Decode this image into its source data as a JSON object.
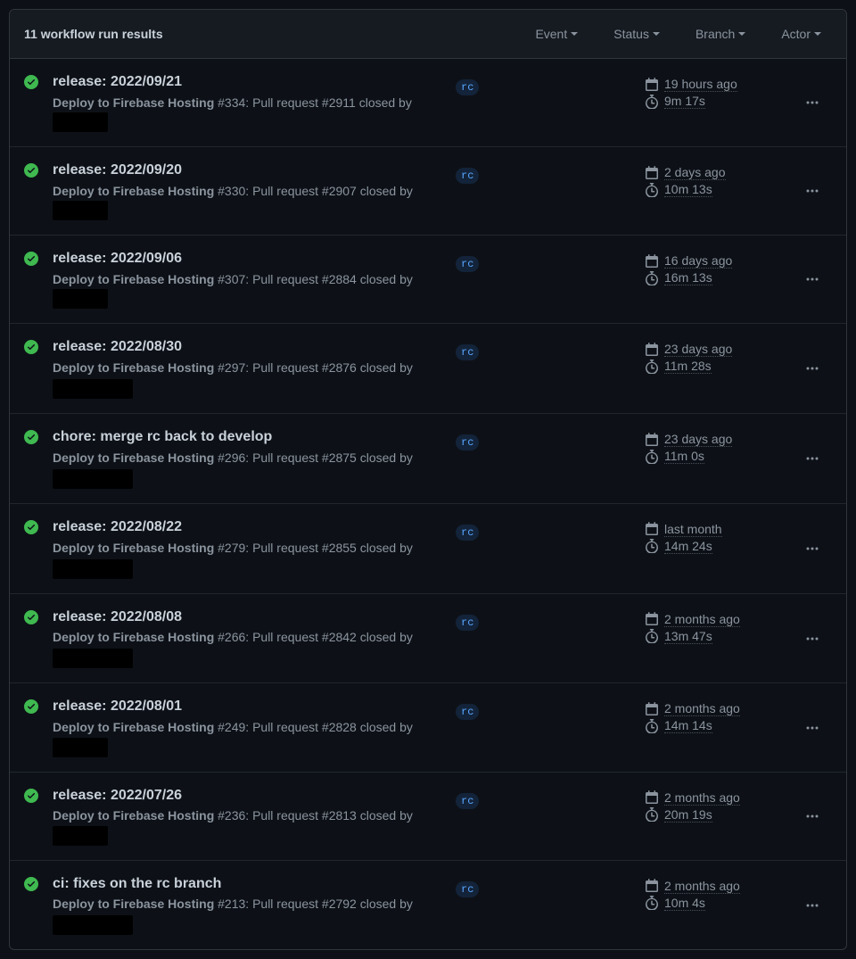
{
  "header": {
    "title": "11 workflow run results",
    "filters": {
      "event": "Event",
      "status": "Status",
      "branch": "Branch",
      "actor": "Actor"
    }
  },
  "workflow_name": "Deploy to Firebase Hosting",
  "runs": [
    {
      "title": "release: 2022/09/21",
      "run_number": "#334",
      "pr": "#2911",
      "branch": "rc",
      "age": "19 hours ago",
      "duration": "9m 17s",
      "redact_inline": true
    },
    {
      "title": "release: 2022/09/20",
      "run_number": "#330",
      "pr": "#2907",
      "branch": "rc",
      "age": "2 days ago",
      "duration": "10m 13s",
      "redact_inline": true
    },
    {
      "title": "release: 2022/09/06",
      "run_number": "#307",
      "pr": "#2884",
      "branch": "rc",
      "age": "16 days ago",
      "duration": "16m 13s",
      "redact_inline": true
    },
    {
      "title": "release: 2022/08/30",
      "run_number": "#297",
      "pr": "#2876",
      "branch": "rc",
      "age": "23 days ago",
      "duration": "11m 28s",
      "redact_inline": false
    },
    {
      "title": "chore: merge rc back to develop",
      "run_number": "#296",
      "pr": "#2875",
      "branch": "rc",
      "age": "23 days ago",
      "duration": "11m 0s",
      "redact_inline": false
    },
    {
      "title": "release: 2022/08/22",
      "run_number": "#279",
      "pr": "#2855",
      "branch": "rc",
      "age": "last month",
      "duration": "14m 24s",
      "redact_inline": false
    },
    {
      "title": "release: 2022/08/08",
      "run_number": "#266",
      "pr": "#2842",
      "branch": "rc",
      "age": "2 months ago",
      "duration": "13m 47s",
      "redact_inline": false
    },
    {
      "title": "release: 2022/08/01",
      "run_number": "#249",
      "pr": "#2828",
      "branch": "rc",
      "age": "2 months ago",
      "duration": "14m 14s",
      "redact_inline": true
    },
    {
      "title": "release: 2022/07/26",
      "run_number": "#236",
      "pr": "#2813",
      "branch": "rc",
      "age": "2 months ago",
      "duration": "20m 19s",
      "redact_inline": true
    },
    {
      "title": "ci: fixes on the rc branch",
      "run_number": "#213",
      "pr": "#2792",
      "branch": "rc",
      "age": "2 months ago",
      "duration": "10m 4s",
      "redact_inline": false
    }
  ],
  "sub_template": {
    "pr_prefix": ": Pull request ",
    "closed_by": " closed by"
  }
}
